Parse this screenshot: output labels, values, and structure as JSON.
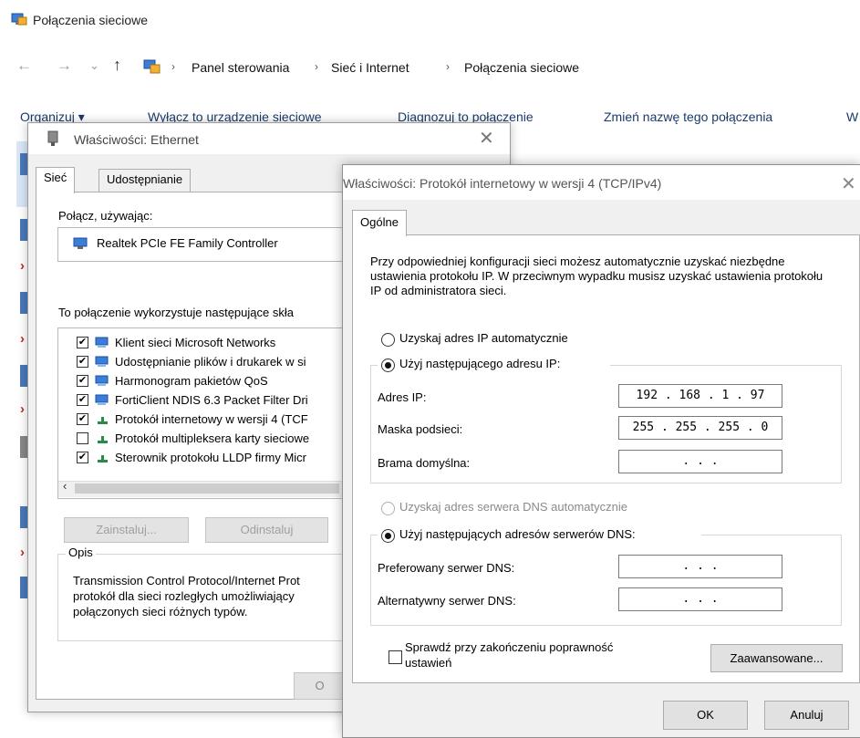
{
  "colors": {
    "accent": "#0063b1",
    "error_x": "#c0282a",
    "dialog_bg": "#f0f0f0"
  },
  "explorer": {
    "title": "Połączenia sieciowe",
    "breadcrumbs": [
      "Panel sterowania",
      "Sieć i Internet",
      "Połączenia sieciowe"
    ],
    "breadcrumb_separator": "›",
    "nav": {
      "back": "←",
      "forward": "→",
      "recent": "⌄",
      "up": "↑"
    },
    "toolbar": [
      "Organizuj ▾",
      "Wyłącz to urządzenie sieciowe",
      "Diagnozuj to połączenie",
      "Zmień nazwę tego połączenia",
      "W"
    ]
  },
  "ethernet_dialog": {
    "title": "Właściwości: Ethernet",
    "close": "✕",
    "tabs": [
      "Sieć",
      "Udostępnianie"
    ],
    "connect_using_label": "Połącz, używając:",
    "adapter": "Realtek PCIe FE Family Controller",
    "components_label": "To połączenie wykorzystuje następujące skła",
    "components": [
      {
        "label": "Klient sieci Microsoft Networks",
        "checked": "✔"
      },
      {
        "label": "Udostępnianie plików i drukarek w si",
        "checked": "✔"
      },
      {
        "label": "Harmonogram pakietów QoS",
        "checked": "✔"
      },
      {
        "label": "FortiClient NDIS 6.3 Packet Filter Dri",
        "checked": "✔"
      },
      {
        "label": "Protokół internetowy w wersji 4 (TCF",
        "checked": "✔"
      },
      {
        "label": "Protokół multipleksera karty sieciowe",
        "checked": ""
      },
      {
        "label": "Sterownik protokołu LLDP firmy Micr",
        "checked": "✔"
      }
    ],
    "scroll_left": "‹",
    "install_button": "Zainstaluj...",
    "uninstall_button": "Odinstaluj",
    "description_title": "Opis",
    "description": "Transmission Control Protocol/Internet Prot protokół dla sieci rozległych umożliwiający połączonych sieci różnych typów.",
    "ok_stub": "O"
  },
  "ipv4_dialog": {
    "title": "Właściwości: Protokół internetowy w wersji 4 (TCP/IPv4)",
    "close": "✕",
    "tab": "Ogólne",
    "intro": "Przy odpowiedniej konfiguracji sieci możesz automatycznie uzyskać niezbędne ustawienia protokołu IP. W przeciwnym wypadku musisz uzyskać ustawienia protokołu IP od administratora sieci.",
    "radio_auto_ip": "Uzyskaj adres IP automatycznie",
    "radio_manual_ip": "Użyj następującego adresu IP:",
    "ip_label": "Adres IP:",
    "ip_value": "192 . 168 .  1  . 97",
    "mask_label": "Maska podsieci:",
    "mask_value": "255 . 255 . 255 .  0",
    "gateway_label": "Brama domyślna:",
    "gateway_value": ".       .       .",
    "radio_auto_dns": "Uzyskaj adres serwera DNS automatycznie",
    "radio_manual_dns": "Użyj następujących adresów serwerów DNS:",
    "pref_dns_label": "Preferowany serwer DNS:",
    "pref_dns_value": ".       .       .",
    "alt_dns_label": "Alternatywny serwer DNS:",
    "alt_dns_value": ".       .       .",
    "validate_line1": "Sprawdź przy zakończeniu poprawność",
    "validate_line2": "ustawień",
    "advanced_button": "Zaawansowane...",
    "ok_button": "OK",
    "cancel_button": "Anuluj"
  }
}
